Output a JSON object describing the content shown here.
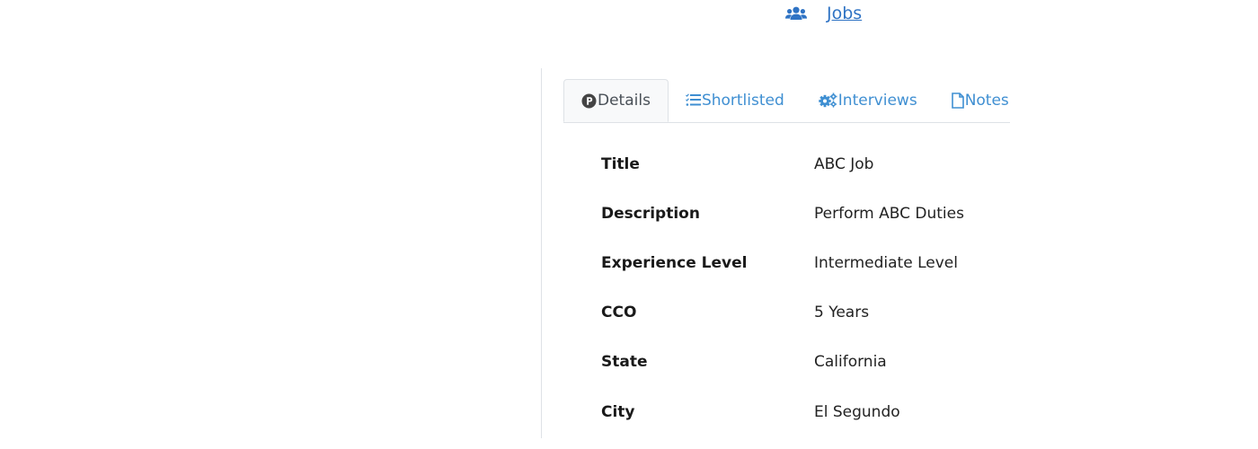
{
  "nav": {
    "jobs_label": "Jobs",
    "jobs_icon": "users-icon"
  },
  "tabs": [
    {
      "label": "Details",
      "icon": "parking-circle-icon",
      "active": true
    },
    {
      "label": "Shortlisted",
      "icon": "tasks-list-icon",
      "active": false
    },
    {
      "label": "Interviews",
      "icon": "cogs-icon",
      "active": false
    },
    {
      "label": "Notes",
      "icon": "file-icon",
      "active": false
    }
  ],
  "details": [
    {
      "label": "Title",
      "value": "ABC Job"
    },
    {
      "label": "Description",
      "value": "Perform ABC Duties"
    },
    {
      "label": "Experience Level",
      "value": "Intermediate Level"
    },
    {
      "label": "CCO",
      "value": "5 Years"
    },
    {
      "label": "State",
      "value": "California"
    },
    {
      "label": "City",
      "value": "El Segundo"
    }
  ],
  "colors": {
    "link": "#2f73c4",
    "tab_link": "#3f8fd2",
    "active_tab_text": "#495057",
    "border": "#dee2e6"
  }
}
